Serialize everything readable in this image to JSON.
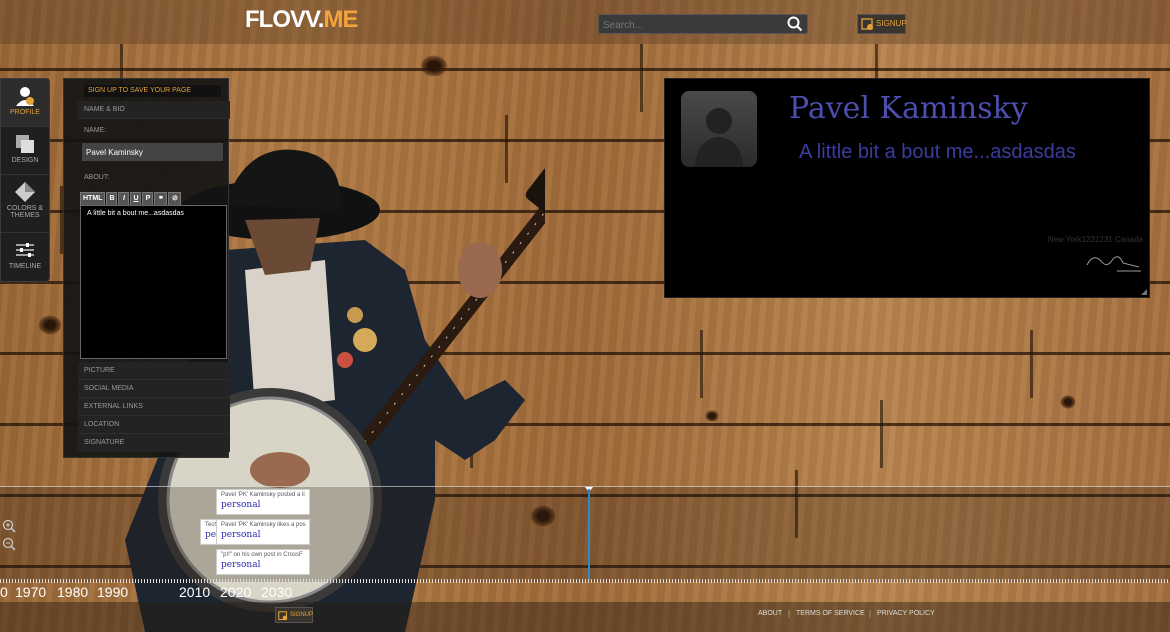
{
  "header": {
    "logo_part1": "FLOVV.",
    "logo_part2": "ME",
    "search_placeholder": "Search...",
    "signup_label": "SIGNUP"
  },
  "toolbar": {
    "items": [
      {
        "label": "PROFILE",
        "icon": "user-icon",
        "active": true
      },
      {
        "label": "DESIGN",
        "icon": "layers-icon",
        "active": false
      },
      {
        "label": "COLORS & THEMES",
        "icon": "diamond-icon",
        "active": false
      },
      {
        "label": "TIMELINE",
        "icon": "sliders-icon",
        "active": false
      }
    ]
  },
  "editor": {
    "save_note": "SIGN UP TO SAVE YOUR PAGE",
    "section_name_bio": "NAME & BIO",
    "name_label": "NAME:",
    "name_value": "Pavel Kaminsky",
    "about_label": "ABOUT:",
    "rte_buttons": [
      "HTML",
      "B",
      "I",
      "U",
      "P",
      "link",
      "unlink"
    ],
    "about_value": "A little bit a bout me...asdasdas",
    "sections": [
      "PICTURE",
      "SOCIAL MEDIA",
      "EXTERNAL LINKS",
      "LOCATION",
      "SIGNATURE"
    ]
  },
  "profile": {
    "name": "Pavel Kaminsky",
    "bio": "A little bit a bout me...asdasdas",
    "location": "New York1231231  Canada"
  },
  "timeline": {
    "cards": [
      {
        "header": "Pavel 'PK' Kaminsky posted a li",
        "tag": "personal"
      },
      {
        "header": "Pavel 'PK' Kaminsky likes a pos",
        "tag": "personal"
      },
      {
        "header": "\"p!!\" on his own post in CrossF",
        "tag": "personal"
      }
    ],
    "back_card": {
      "header": "Tech",
      "tag": "pers"
    },
    "years": [
      "0",
      "1970",
      "1980",
      "1990",
      "2010",
      "2020",
      "2030"
    ]
  },
  "footer": {
    "links": [
      "ABOUT",
      "TERMS OF SERVICE",
      "PRIVACY POLICY"
    ],
    "signup_label": "SIGNUP"
  },
  "colors": {
    "accent": "#e3a33a",
    "name_color": "#4d4fb0",
    "timeline_line": "#2f88c8"
  }
}
